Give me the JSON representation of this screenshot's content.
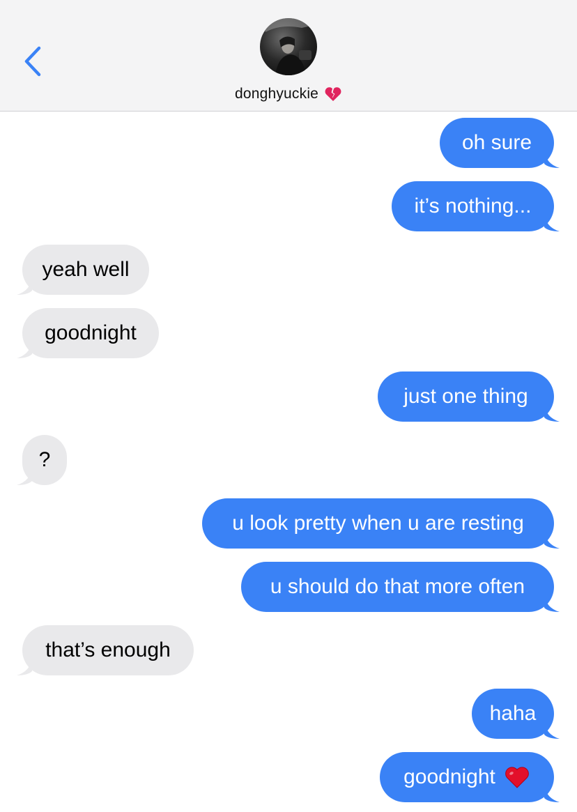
{
  "header": {
    "contact_name": "donghyuckie",
    "back_icon": "chevron-left-icon",
    "status_icon": "broken-heart-emoji",
    "accent_color": "#3a82f6"
  },
  "messages": [
    {
      "direction": "outgoing",
      "text": "oh sure"
    },
    {
      "direction": "outgoing",
      "text": "it’s nothing..."
    },
    {
      "direction": "incoming",
      "text": "yeah well"
    },
    {
      "direction": "incoming",
      "text": "goodnight"
    },
    {
      "direction": "outgoing",
      "text": "just one thing"
    },
    {
      "direction": "incoming",
      "text": "?"
    },
    {
      "direction": "outgoing",
      "text": "u look pretty when u are resting"
    },
    {
      "direction": "outgoing",
      "text": "u should do that more often"
    },
    {
      "direction": "incoming",
      "text": "that’s enough"
    },
    {
      "direction": "outgoing",
      "text": "haha"
    },
    {
      "direction": "outgoing",
      "text": "goodnight",
      "emoji": "red-heart-emoji"
    }
  ],
  "colors": {
    "outgoing_bubble": "#3a82f6",
    "incoming_bubble": "#e9e9eb",
    "header_bg": "#f4f4f5"
  }
}
